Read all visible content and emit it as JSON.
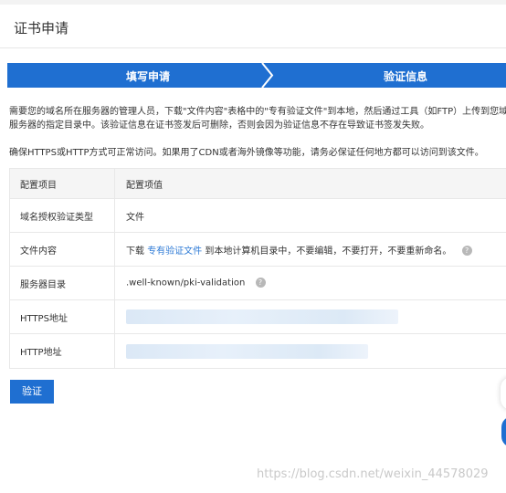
{
  "page": {
    "title": "证书申请"
  },
  "steps": [
    {
      "label": "填写申请",
      "state": "done"
    },
    {
      "label": "验证信息",
      "state": "active"
    }
  ],
  "colors": {
    "step_bg": "#1f6fd1",
    "link": "#2f7bd6",
    "button": "#1f6fd1"
  },
  "instructions": {
    "line1": "需要您的域名所在服务器的管理人员，下载\"文件内容\"表格中的\"专有验证文件\"到本地，然后通过工具（如FTP）上传到您域名",
    "line2": "服务器的指定目录中。该验证信息在证书签发后可删除，否则会因为验证信息不存在导致证书签发失败。",
    "line3": "确保HTTPS或HTTP方式可正常访问。如果用了CDN或者海外镜像等功能，请务必保证任何地方都可以访问到该文件。"
  },
  "table": {
    "headers": [
      "配置项目",
      "配置项值"
    ],
    "rows": {
      "type": {
        "key": "域名授权验证类型",
        "value": "文件"
      },
      "file": {
        "key": "文件内容",
        "prefix": "下载",
        "link": "专有验证文件",
        "suffix": "到本地计算机目录中，不要编辑，不要打开，不要重新命名。",
        "icon": "help-icon"
      },
      "dir": {
        "key": "服务器目录",
        "value": ".well-known/pki-validation",
        "icon": "help-icon"
      },
      "https": {
        "key": "HTTPS地址"
      },
      "http": {
        "key": "HTTP地址"
      }
    }
  },
  "actions": {
    "verify_label": "验证"
  },
  "watermark": "https://blog.csdn.net/weixin_44578029"
}
